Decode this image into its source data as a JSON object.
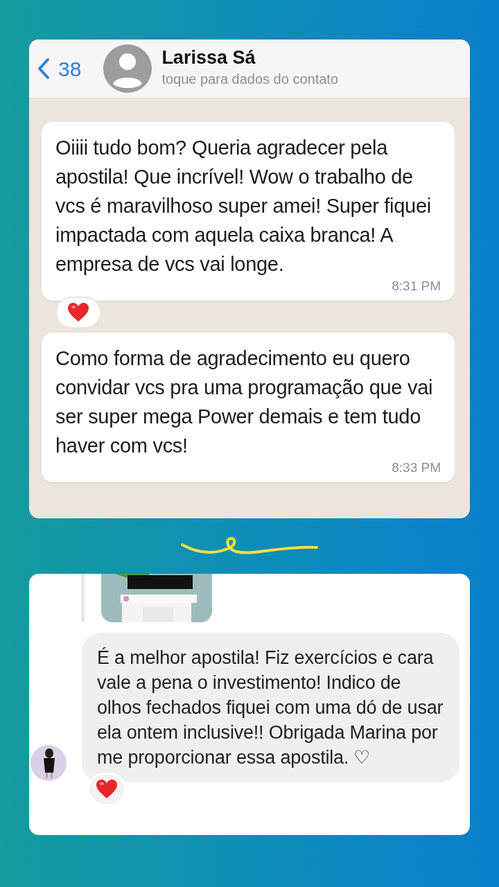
{
  "whatsapp_chat": {
    "header": {
      "back_count": "38",
      "contact_name": "Larissa Sá",
      "subtitle": "toque para dados do contato"
    },
    "messages": [
      {
        "text": "Oiiii tudo bom? Queria agradecer pela apostila! Que incrível! Wow o trabalho de vcs é maravilhoso super amei! Super fiquei impactada com aquela caixa branca! A empresa de vcs vai longe.",
        "time": "8:31 PM",
        "reacted": true
      },
      {
        "text": "Como forma de agradecimento eu quero convidar vcs pra uma programação que vai ser super mega Power demais e tem tudo haver com vcs!",
        "time": "8:33 PM",
        "reacted": false
      }
    ]
  },
  "instagram_reply": {
    "message": {
      "text": "É a melhor apostila! Fiz exercícios e cara vale a pena o investimento! Indico de olhos fechados fiquei com uma dó de usar ela ontem inclusive!! Obrigada Marina por me proporcionar essa apostila. ♡",
      "reacted": true
    }
  }
}
